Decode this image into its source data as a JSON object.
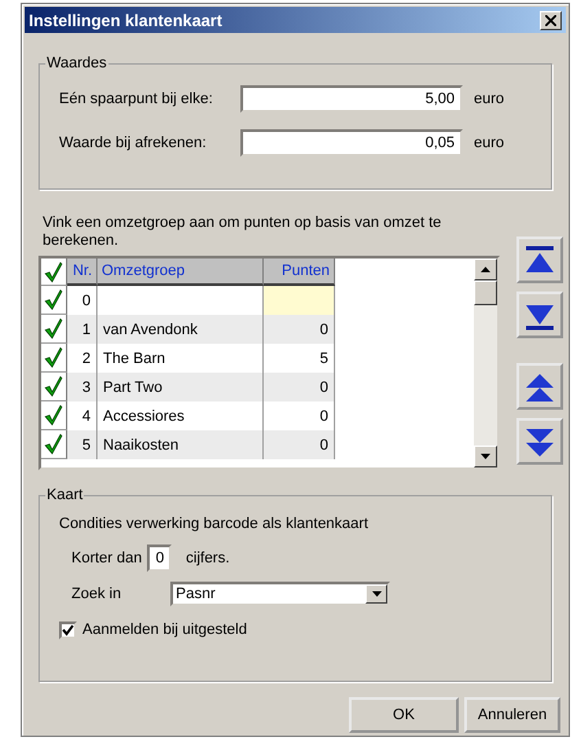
{
  "window": {
    "title": "Instellingen klantenkaart"
  },
  "waardes": {
    "title": "Waardes",
    "fields": [
      {
        "label": "Eén spaarpunt bij elke:",
        "value": "5,00",
        "unit": "euro"
      },
      {
        "label": "Waarde bij afrekenen:",
        "value": "0,05",
        "unit": "euro"
      }
    ]
  },
  "instruction": "Vink een omzetgroep aan om punten op basis van omzet te berekenen.",
  "grid": {
    "header_checked": true,
    "columns": [
      "Nr.",
      "Omzetgroep",
      "Punten"
    ],
    "rows": [
      {
        "nr": "0",
        "name": "",
        "points": "",
        "checked": true,
        "selected": true
      },
      {
        "nr": "1",
        "name": "van Avendonk",
        "points": "0",
        "checked": true,
        "selected": false
      },
      {
        "nr": "2",
        "name": "The Barn",
        "points": "5",
        "checked": true,
        "selected": false
      },
      {
        "nr": "3",
        "name": "Part Two",
        "points": "0",
        "checked": true,
        "selected": false
      },
      {
        "nr": "4",
        "name": "Accessiores",
        "points": "0",
        "checked": true,
        "selected": false
      },
      {
        "nr": "5",
        "name": "Naaikosten",
        "points": "0",
        "checked": true,
        "selected": false
      }
    ]
  },
  "move_buttons": [
    {
      "kind": "top"
    },
    {
      "kind": "bottom"
    },
    {
      "kind": "up"
    },
    {
      "kind": "down"
    }
  ],
  "kaart": {
    "title": "Kaart",
    "description": "Condities verwerking barcode als klantenkaart",
    "shorter": {
      "label": "Korter dan",
      "value": "0",
      "unit": "cijfers."
    },
    "search": {
      "label": "Zoek in",
      "value": "Pasnr"
    },
    "checkbox": {
      "label": "Aanmelden bij uitgesteld",
      "checked": true
    }
  },
  "buttons": [
    "OK",
    "Annuleren"
  ]
}
